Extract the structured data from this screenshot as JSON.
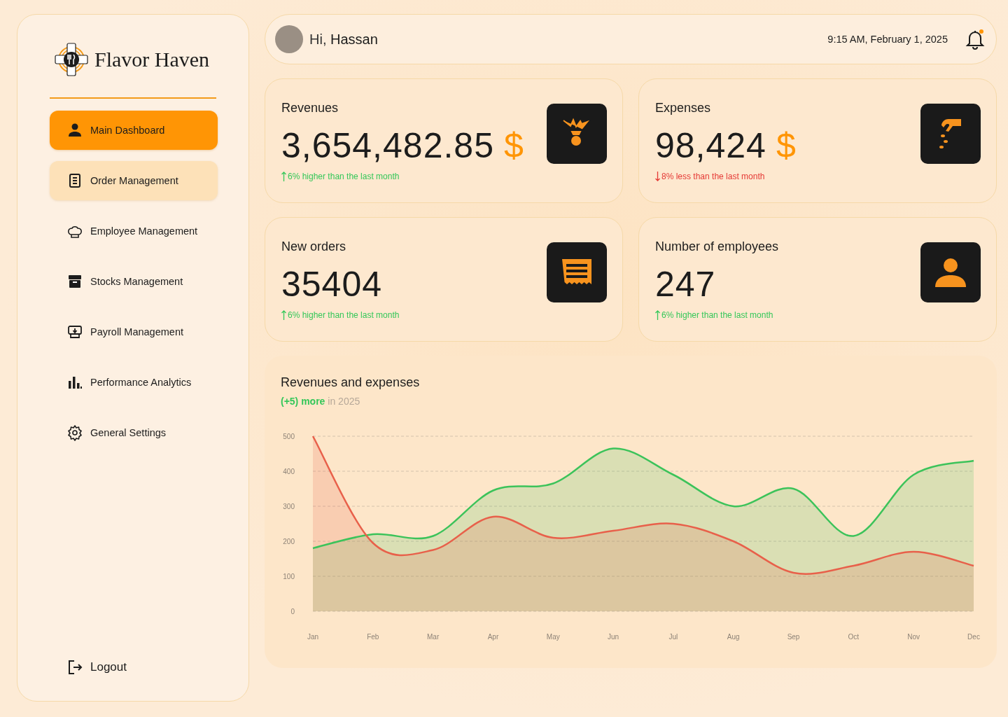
{
  "brand": {
    "name": "Flavor Haven"
  },
  "nav": [
    {
      "label": "Main Dashboard",
      "selected": true,
      "hovered": false
    },
    {
      "label": "Order Management",
      "selected": false,
      "hovered": true
    },
    {
      "label": "Employee Management",
      "selected": false,
      "hovered": false
    },
    {
      "label": "Stocks Management",
      "selected": false,
      "hovered": false
    },
    {
      "label": "Payroll Management",
      "selected": false,
      "hovered": false
    },
    {
      "label": "Performance Analytics",
      "selected": false,
      "hovered": false
    },
    {
      "label": "General Settings",
      "selected": false,
      "hovered": false
    }
  ],
  "logout": {
    "label": "Logout"
  },
  "header": {
    "greeting": "Hi,",
    "user": "Hassan",
    "datetime": "9:15 AM, February 1, 2025",
    "notification_unread": true
  },
  "stats": [
    {
      "title": "Revenues",
      "value": "3,654,482.85",
      "currency": "$",
      "trend_up": true,
      "note": "6% higher than the last month"
    },
    {
      "title": "Expenses",
      "value": "98,424",
      "currency": "$",
      "trend_up": false,
      "note": "8% less than the last month"
    },
    {
      "title": "New orders",
      "value": "35404",
      "trend_up": true,
      "note": "6% higher than the last month"
    },
    {
      "title": "Number of employees",
      "value": "247",
      "trend_up": true,
      "note": "6% higher than the last month"
    }
  ],
  "chart": {
    "title": "Revenues and expenses",
    "subtitle": "**(+5) more** in 2025",
    "chart_data": {
      "type": "area",
      "categories": [
        "Jan",
        "Feb",
        "Mar",
        "Apr",
        "May",
        "Jun",
        "Jul",
        "Aug",
        "Sep",
        "Oct",
        "Nov",
        "Dec"
      ],
      "ylim": [
        0,
        500
      ],
      "yticks": [
        0,
        100,
        200,
        300,
        400,
        500
      ],
      "grid": true,
      "series": [
        {
          "color": "#3cc35a",
          "values": [
            180,
            220,
            215,
            345,
            365,
            465,
            390,
            300,
            350,
            215,
            390,
            430
          ]
        },
        {
          "color": "#e8604a",
          "values": [
            500,
            195,
            175,
            270,
            210,
            230,
            250,
            200,
            110,
            130,
            170,
            130
          ]
        }
      ]
    }
  }
}
